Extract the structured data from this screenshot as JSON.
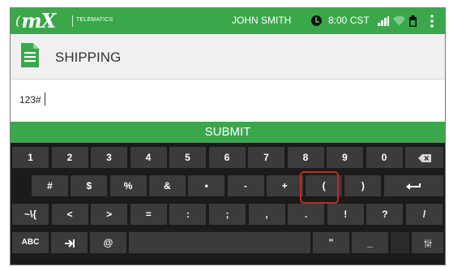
{
  "status_bar": {
    "brand": "mX",
    "brand_prefix": "(",
    "telematics": "TELEMATICS",
    "user": "JOHN SMITH",
    "time": "8:00 CST",
    "icons": [
      "clock-icon",
      "signal-icon",
      "wifi-icon",
      "battery-icon",
      "overflow-menu-icon"
    ]
  },
  "header": {
    "title": "SHIPPING",
    "icon": "document-icon"
  },
  "input": {
    "value": "123#"
  },
  "submit": {
    "label": "SUBMIT"
  },
  "keyboard": {
    "row1": [
      "1",
      "2",
      "3",
      "4",
      "5",
      "6",
      "7",
      "8",
      "9",
      "0"
    ],
    "row1_hints": [
      "",
      "",
      "",
      "",
      "",
      "",
      "",
      "",
      "",
      ""
    ],
    "row2": [
      "#",
      "$",
      "%",
      "&",
      "•",
      "-",
      "+",
      "(",
      ")"
    ],
    "row3": [
      "~\\{",
      "<",
      ">",
      "=",
      ":",
      ";",
      ",",
      ".",
      "!",
      "?",
      "/"
    ],
    "row4": [
      "ABC",
      "@",
      "\"",
      "_"
    ],
    "icons": [
      "backspace-icon",
      "enter-icon",
      "tab-icon",
      "settings-icon"
    ]
  },
  "colors": {
    "brand_green": "#3aa84a",
    "highlight": "#c22a25",
    "keyboard_bg": "#1b1b1b",
    "key_bg": "#3b3b3b"
  }
}
